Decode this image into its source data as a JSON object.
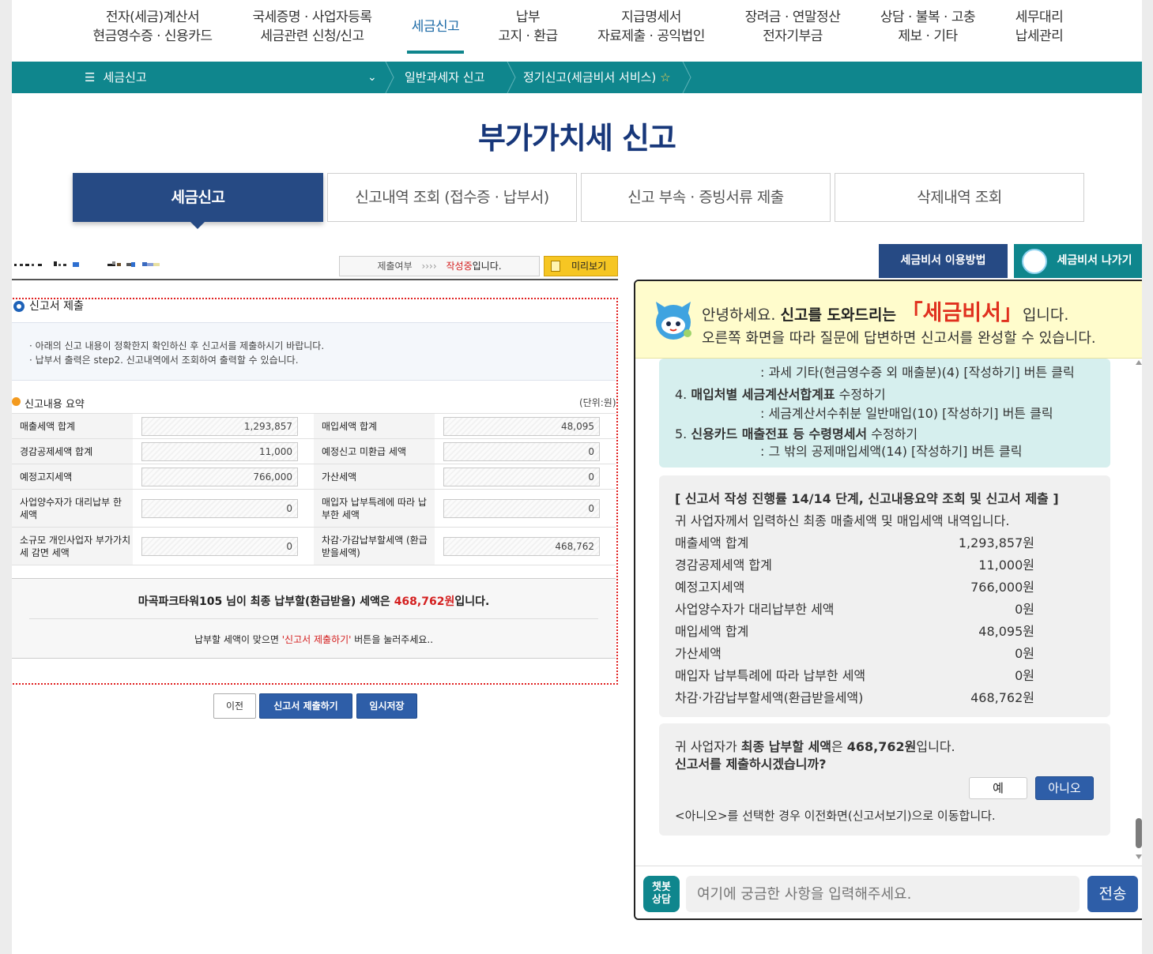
{
  "top_menu": [
    {
      "line1": "전자(세금)계산서",
      "line2": "현금영수증 · 신용카드"
    },
    {
      "line1": "국세증명 · 사업자등록",
      "line2": "세금관련 신청/신고"
    },
    {
      "line1": "세금신고",
      "line2": ""
    },
    {
      "line1": "납부",
      "line2": "고지 · 환급"
    },
    {
      "line1": "지급명세서",
      "line2": "자료제출 · 공익법인"
    },
    {
      "line1": "장려금 · 연말정산",
      "line2": "전자기부금"
    },
    {
      "line1": "상담 · 불복 · 고충",
      "line2": "제보 · 기타"
    },
    {
      "line1": "세무대리",
      "line2": "납세관리"
    }
  ],
  "breadcrumb": {
    "menu_label": "세금신고",
    "level2": "일반과세자 신고",
    "level3": "정기신고(세금비서 서비스)"
  },
  "page_title": "부가가치세 신고",
  "tabs": [
    "세금신고",
    "신고내역 조회 (접수증 · 납부서)",
    "신고 부속 · 증빙서류 제출",
    "삭제내역 조회"
  ],
  "status": {
    "label": "제출여부",
    "arrows": "››››",
    "state": "작성중",
    "suffix": "입니다."
  },
  "preview_button": "미리보기",
  "section_title": "신고서 제출",
  "notices": [
    "· 아래의 신고 내용이 정확한지 확인하신 후 신고서를 제출하시기 바랍니다.",
    "· 납부서 출력은 step2. 신고내역에서 조회하여 출력할 수 있습니다."
  ],
  "summary": {
    "title": "신고내용 요약",
    "unit": "(단위:원)",
    "rows": [
      {
        "l1": "매출세액 합계",
        "v1": "1,293,857",
        "l2": "매입세액 합계",
        "v2": "48,095"
      },
      {
        "l1": "경감공제세액 합계",
        "v1": "11,000",
        "l2": "예정신고 미환급 세액",
        "v2": "0"
      },
      {
        "l1": "예정고지세액",
        "v1": "766,000",
        "l2": "가산세액",
        "v2": "0"
      },
      {
        "l1": "사업양수자가 대리납부 한 세액",
        "v1": "0",
        "l2": "매입자 납부특례에 따라 납부한 세액",
        "v2": "0"
      },
      {
        "l1": "소규모 개인사업자 부가가치세 감면 세액",
        "v1": "0",
        "l2": "차감·가감납부할세액 (환급받을세액)",
        "v2": "468,762"
      }
    ]
  },
  "result": {
    "prefix": "마곡파크타워105 님이 최종 납부할(환급받을) 세액은 ",
    "amount": "468,762원",
    "suffix": "입니다.",
    "hint_prefix": "납부할 세액이 맞으면 ",
    "hint_button": "'신고서 제출하기'",
    "hint_suffix": " 버튼을 눌러주세요.."
  },
  "buttons": {
    "prev": "이전",
    "submit": "신고서 제출하기",
    "temp_save": "임시저장"
  },
  "right_buttons": {
    "howto": "세금비서 이용방법",
    "exit": "세금비서 나가기"
  },
  "chat": {
    "greeting_pre": "안녕하세요. ",
    "greeting_bold": "신고를 도와드리는 ",
    "greeting_brand": "「세금비서」",
    "greeting_post": "입니다.",
    "greeting_line2": "오른쪽 화면을 따라 질문에 답변하면 신고서를 완성할 수 있습니다.",
    "bubble1": {
      "line0": ": 과세 기타(현금영수증 외 매출분)(4) [작성하기] 버튼 클릭",
      "item4_num": "4. ",
      "item4_bold": "매입처별 세금계산서합계표",
      "item4_rest": " 수정하기",
      "item4_sub": ": 세금계산서수취분 일반매입(10) [작성하기] 버튼 클릭",
      "item5_num": "5. ",
      "item5_bold": "신용카드 매출전표 등 수령명세서",
      "item5_rest": " 수정하기",
      "item5_sub": ": 그 밖의 공제매입세액(14) [작성하기] 버튼 클릭"
    },
    "bubble2": {
      "heading_pre": "[ 신고서 작성 진행률 ",
      "heading_bold": "14/14",
      "heading_post": " 단계, 신고내용요약 조회 및 신고서 제출 ]",
      "intro": "귀 사업자께서 입력하신 최종 매출세액 및 매입세액 내역입니다.",
      "rows": [
        {
          "label": "매출세액 합계",
          "amount": "1,293,857원"
        },
        {
          "label": "경감공제세액 합계",
          "amount": "11,000원"
        },
        {
          "label": "예정고지세액",
          "amount": "766,000원"
        },
        {
          "label": "사업양수자가 대리납부한 세액",
          "amount": "0원"
        },
        {
          "label": "매입세액 합계",
          "amount": "48,095원"
        },
        {
          "label": "가산세액",
          "amount": "0원"
        },
        {
          "label": "매입자 납부특례에 따라 납부한 세액",
          "amount": "0원"
        },
        {
          "label": "차감·가감납부할세액(환급받을세액)",
          "amount": "468,762원"
        }
      ]
    },
    "bubble3": {
      "pre": "귀 사업자가 ",
      "bold1": "최종 납부할 세액",
      "mid": "은 ",
      "bold2": "468,762원",
      "post": "입니다.",
      "question": "신고서를 제출하시겠습니까?",
      "yes": "예",
      "no": "아니오",
      "note": "<아니오>를 선택한 경우 이전화면(신고서보기)으로 이동합니다."
    },
    "chatbot_label_1": "챗봇",
    "chatbot_label_2": "상담",
    "input_placeholder": "여기에 궁금한 사항을 입력해주세요.",
    "send": "전송"
  },
  "colors": {
    "teal": "#0f868d",
    "navy": "#264a84",
    "title_blue": "#17377a",
    "red": "#d42020"
  }
}
